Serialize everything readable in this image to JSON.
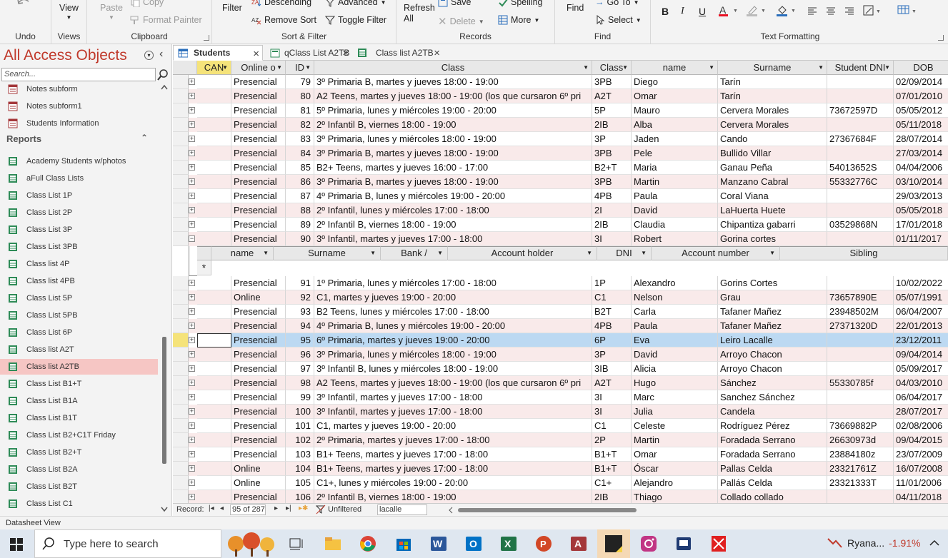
{
  "ribbon": {
    "undo": "Undo",
    "views_btn": "View",
    "views_group": "Views",
    "paste": "Paste",
    "copy": "Copy",
    "format_painter": "Format Painter",
    "clipboard_group": "Clipboard",
    "filter": "Filter",
    "descending": "Descending",
    "remove_sort": "Remove Sort",
    "advanced": "Advanced",
    "toggle_filter": "Toggle Filter",
    "sort_group": "Sort & Filter",
    "refresh_all": "Refresh All",
    "save": "Save",
    "delete": "Delete",
    "spelling": "Spelling",
    "more": "More",
    "records_group": "Records",
    "find": "Find",
    "goto": "Go To",
    "select": "Select",
    "find_group": "Find",
    "text_group": "Text Formatting"
  },
  "nav": {
    "title": "All Access Objects",
    "search_placeholder": "Search...",
    "forms": [
      "Notes subform",
      "Notes subform1",
      "Students Information"
    ],
    "reports_label": "Reports",
    "reports": [
      "Academy Students w/photos",
      "aFull Class Lists",
      "Class List 1P",
      "Class List 2P",
      "Class List 3P",
      "Class List 3PB",
      "Class list 4P",
      "Class list 4PB",
      "Class List 5P",
      "Class List 5PB",
      "Class List 6P",
      "Class list A2T",
      "Class list A2TB",
      "Class List B1+T",
      "Class List B1A",
      "Class List B1T",
      "Class List B2+C1T  Friday",
      "Class List B2+T",
      "Class List B2A",
      "Class List B2T",
      "Class List C1",
      "Class List C1+"
    ],
    "selected_report": "Class list A2TB"
  },
  "tabs": [
    {
      "label": "Students",
      "active": true
    },
    {
      "label": "qClass List A2TB",
      "active": false
    },
    {
      "label": "Class list A2TB",
      "active": false
    }
  ],
  "grid": {
    "headers": [
      "CAN",
      "Online o",
      "ID",
      "Class",
      "Class",
      "name",
      "Surname",
      "Student DNI",
      "DOB"
    ],
    "rows": [
      [
        "",
        "Presencial",
        "79",
        "3º Primaria B, martes y jueves 18:00 - 19:00",
        "3PB",
        "Diego",
        "Tarín",
        "",
        "02/09/2014"
      ],
      [
        "",
        "Presencial",
        "80",
        "A2 Teens, martes y jueves 18:00 - 19:00 (los que cursaron 6º pri",
        "A2T",
        "Omar",
        "Tarín",
        "",
        "07/01/2010"
      ],
      [
        "",
        "Presencial",
        "81",
        "5º Primaria,  lunes y miércoles  19:00 - 20:00",
        "5P",
        "Mauro",
        "Cervera Morales",
        "73672597D",
        "05/05/2012"
      ],
      [
        "",
        "Presencial",
        "82",
        "2º Infantil B, viernes 18:00 - 19:00",
        "2IB",
        "Alba",
        "Cervera Morales",
        "",
        "05/11/2018"
      ],
      [
        "",
        "Presencial",
        "83",
        "3º Primaria, lunes y miércoles 18:00 - 19:00",
        "3P",
        "Jaden",
        "Cando",
        "27367684F",
        "28/07/2014"
      ],
      [
        "",
        "Presencial",
        "84",
        "3º Primaria B, martes y jueves 18:00 - 19:00",
        "3PB",
        "Pele",
        "Bullido Villar",
        "",
        "27/03/2014"
      ],
      [
        "",
        "Presencial",
        "85",
        "B2+ Teens, martes y jueves 16:00 - 17:00",
        "B2+T",
        "Maria",
        "Ganau Peña",
        "54013652S",
        "04/04/2006"
      ],
      [
        "",
        "Presencial",
        "86",
        "3º Primaria B, martes y jueves 18:00 - 19:00",
        "3PB",
        "Martin",
        "Manzano Cabral",
        "55332776C",
        "03/10/2014"
      ],
      [
        "",
        "Presencial",
        "87",
        "4º Primaria B,  lunes y miércoles  19:00 - 20:00",
        "4PB",
        "Paula",
        "Coral Viana",
        "",
        "29/03/2013"
      ],
      [
        "",
        "Presencial",
        "88",
        "2º Infantil, lunes y miércoles 17:00 - 18:00",
        "2I",
        "David",
        "LaHuerta Huete",
        "",
        "05/05/2018"
      ],
      [
        "",
        "Presencial",
        "89",
        "2º Infantil B, viernes 18:00 - 19:00",
        "2IB",
        "Claudia",
        "Chipantiza gabarri",
        "03529868N",
        "17/01/2018"
      ],
      [
        "",
        "Presencial",
        "90",
        "3º Infantil, martes y jueves 17:00 - 18:00",
        "3I",
        "Robert",
        "Gorina cortes",
        "",
        "01/11/2017"
      ],
      [
        "",
        "Presencial",
        "91",
        "1º Primaria, lunes y miércoles 17:00 - 18:00",
        "1P",
        "Alexandro",
        "Gorins Cortes",
        "",
        "10/02/2022"
      ],
      [
        "",
        "Online",
        "92",
        "C1, martes y jueves 19:00 - 20:00",
        "C1",
        "Nelson",
        "Grau",
        "73657890E",
        "05/07/1991"
      ],
      [
        "",
        "Presencial",
        "93",
        "B2 Teens, lunes y miércoles 17:00 - 18:00",
        "B2T",
        "Carla",
        "Tafaner Mañez",
        "23948502M",
        "06/04/2007"
      ],
      [
        "",
        "Presencial",
        "94",
        "4º Primaria B,  lunes y miércoles  19:00 - 20:00",
        "4PB",
        "Paula",
        "Tafaner Mañez",
        "27371320D",
        "22/01/2013"
      ],
      [
        "",
        "Presencial",
        "95",
        "6º Primaria, martes y jueves 19:00 - 20:00",
        "6P",
        "Eva",
        "Leiro Lacalle",
        "",
        "23/12/2011"
      ],
      [
        "",
        "Presencial",
        "96",
        "3º Primaria, lunes y miércoles 18:00 - 19:00",
        "3P",
        "David",
        "Arroyo Chacon",
        "",
        "09/04/2014"
      ],
      [
        "",
        "Presencial",
        "97",
        "3º Infantil B, lunes y miércoles 18:00 - 19:00",
        "3IB",
        "Alicia",
        "Arroyo Chacon",
        "",
        "05/09/2017"
      ],
      [
        "",
        "Presencial",
        "98",
        "A2 Teens, martes y jueves 18:00 - 19:00 (los que cursaron 6º pri",
        "A2T",
        "Hugo",
        "Sánchez",
        "55330785f",
        "04/03/2010"
      ],
      [
        "",
        "Presencial",
        "99",
        "3º Infantil, martes y jueves 17:00 - 18:00",
        "3I",
        "Marc",
        "Sanchez Sánchez",
        "",
        "06/04/2017"
      ],
      [
        "",
        "Presencial",
        "100",
        "3º Infantil, martes y jueves 17:00 - 18:00",
        "3I",
        "Julia",
        "Candela",
        "",
        "28/07/2017"
      ],
      [
        "",
        "Presencial",
        "101",
        "C1, martes y jueves 19:00 - 20:00",
        "C1",
        "Celeste",
        "Rodríguez Pérez",
        "73669882P",
        "02/08/2006"
      ],
      [
        "",
        "Presencial",
        "102",
        "2º Primaria, martes y jueves 17:00 - 18:00",
        "2P",
        "Martin",
        "Foradada Serrano",
        "26630973d",
        "09/04/2015"
      ],
      [
        "",
        "Presencial",
        "103",
        "B1+ Teens, martes y jueves 17:00 - 18:00",
        "B1+T",
        "Omar",
        "Foradada Serrano",
        "23884180z",
        "23/07/2009"
      ],
      [
        "",
        "Online",
        "104",
        "B1+ Teens, martes y jueves 17:00 - 18:00",
        "B1+T",
        "Óscar",
        "Pallas Celda",
        "23321761Z",
        "16/07/2008"
      ],
      [
        "",
        "Online",
        "105",
        "C1+, lunes y miércoles 19:00 - 20:00",
        "C1+",
        "Alejandro",
        "Pallás Celda",
        "23321333T",
        "11/01/2006"
      ],
      [
        "",
        "Presencial",
        "106",
        "2º Infantil B, viernes 18:00 - 19:00",
        "2IB",
        "Thiago",
        "Collado collado",
        "",
        "04/11/2018"
      ]
    ],
    "selected_id": "95",
    "sub_headers": [
      "name",
      "Surname",
      "Bank /",
      "Account holder",
      "DNI",
      "Account number",
      "Sibling"
    ],
    "new_row_marker": "*"
  },
  "recnav": {
    "label": "Record:",
    "position": "95 of 287",
    "filter_state": "Unfiltered",
    "search_value": "lacalle"
  },
  "status": {
    "view": "Datasheet View"
  },
  "taskbar": {
    "search_placeholder": "Type here to search",
    "stock_name": "Ryana...",
    "stock_change": "-1.91%"
  }
}
